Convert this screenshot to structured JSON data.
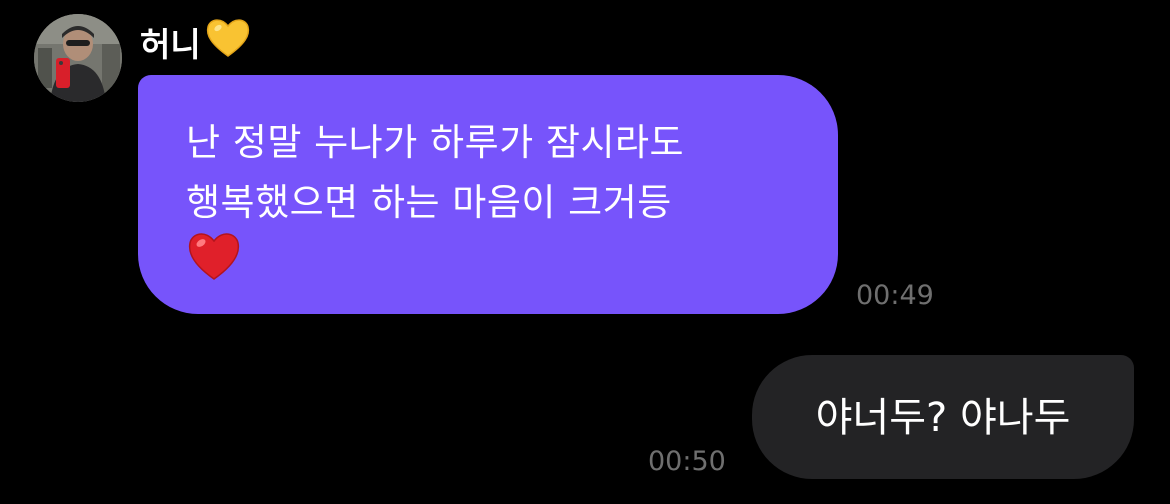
{
  "contact": {
    "name": "허니",
    "name_emoji_icon": "yellow-heart-icon",
    "avatar_icon": "profile-photo"
  },
  "messages": [
    {
      "direction": "incoming",
      "lines": [
        "난 정말 누나가 하루가 잠시라도",
        "행복했으면 하는 마음이 크거등"
      ],
      "emoji_icon": "red-heart-icon",
      "time": "00:49"
    },
    {
      "direction": "outgoing",
      "text": "야너두? 야나두",
      "time": "00:50"
    }
  ],
  "colors": {
    "background": "#000000",
    "incoming_bubble": "#7754fb",
    "outgoing_bubble": "#232325",
    "timestamp": "#6f6f6f",
    "yellow_heart": "#f9c332",
    "red_heart": "#e0202a"
  }
}
